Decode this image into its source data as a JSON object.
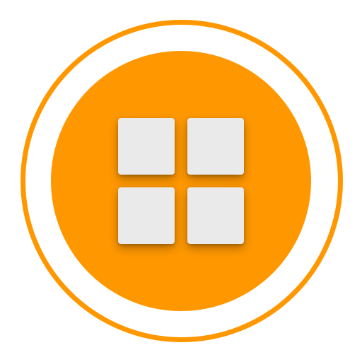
{
  "app_icon": {
    "icon": "grid-apps-icon",
    "colors": {
      "accent": "#FF9800",
      "tile": "#EAEAEA",
      "background": "#FFFFFF"
    },
    "tiles": [
      "top-left",
      "top-right",
      "bottom-left",
      "bottom-right"
    ]
  }
}
